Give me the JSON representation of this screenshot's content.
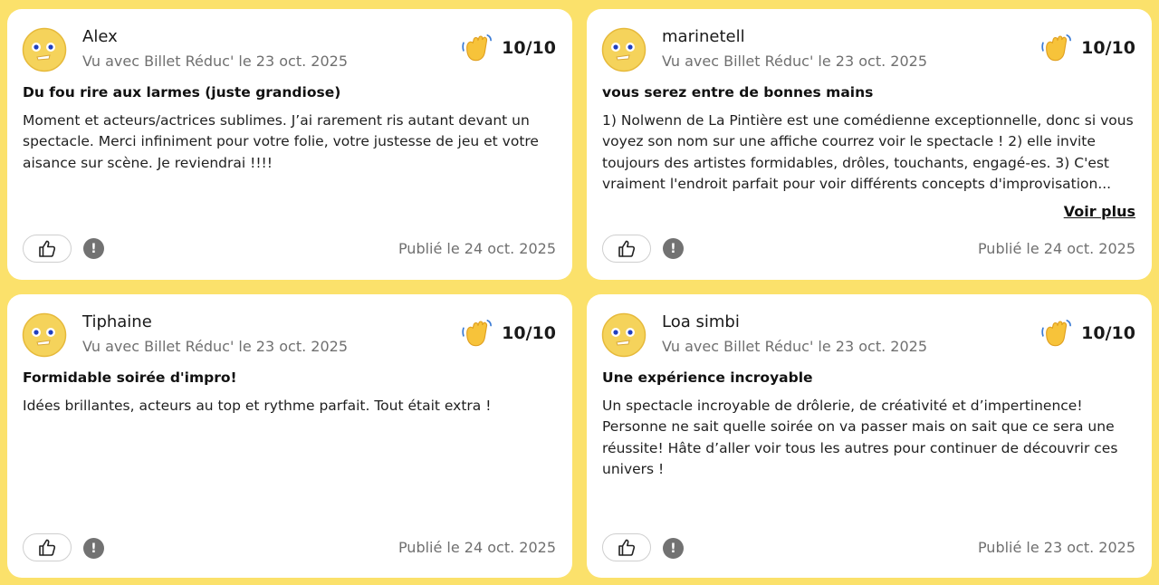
{
  "reviews": [
    {
      "username": "Alex",
      "seen_with": "Vu avec Billet Réduc' le 23 oct. 2025",
      "score": "10/10",
      "title": "Du fou rire aux larmes (juste grandiose)",
      "body": "Moment et acteurs/actrices sublimes. J’ai rarement ris autant devant un spectacle. Merci infiniment pour votre folie, votre justesse de jeu et votre aisance sur scène. Je reviendrai !!!!",
      "published": "Publié le 24 oct. 2025"
    },
    {
      "username": "marinetell",
      "seen_with": "Vu avec Billet Réduc' le 23 oct. 2025",
      "score": "10/10",
      "title": "vous serez entre de bonnes mains",
      "body": "1) Nolwenn de La Pintière est une comédienne exceptionnelle, donc si vous voyez son nom sur une affiche courrez voir le spectacle ! 2) elle invite toujours des artistes formidables, drôles, touchants, engagé-es. 3) C'est vraiment l'endroit parfait pour voir différents concepts d'improvisation...",
      "voir_plus": "Voir plus",
      "published": "Publié le 24 oct. 2025"
    },
    {
      "username": "Tiphaine",
      "seen_with": "Vu avec Billet Réduc' le 23 oct. 2025",
      "score": "10/10",
      "title": "Formidable soirée d'impro!",
      "body": "Idées brillantes, acteurs au top et rythme parfait. Tout était extra !",
      "published": "Publié le 24 oct. 2025"
    },
    {
      "username": "Loa simbi",
      "seen_with": "Vu avec Billet Réduc' le 23 oct. 2025",
      "score": "10/10",
      "title": "Une expérience incroyable",
      "body": "Un spectacle incroyable de drôlerie, de créativité et d’impertinence! Personne ne sait quelle soirée on va passer mais on sait que ce sera une réussite! Hâte d’aller voir tous les autres pour continuer de découvrir ces univers !",
      "published": "Publié le 23 oct. 2025"
    }
  ],
  "icons": {
    "avatar": "smiley-face-icon",
    "rating": "waving-hand-icon",
    "like": "thumbs-up-icon",
    "report": "exclamation-icon"
  },
  "colors": {
    "background": "#FBE16B",
    "card": "#FFFFFF",
    "avatar_face": "#F5D35B",
    "wave_hand": "#F7C33A",
    "secondary_text": "#707070"
  }
}
